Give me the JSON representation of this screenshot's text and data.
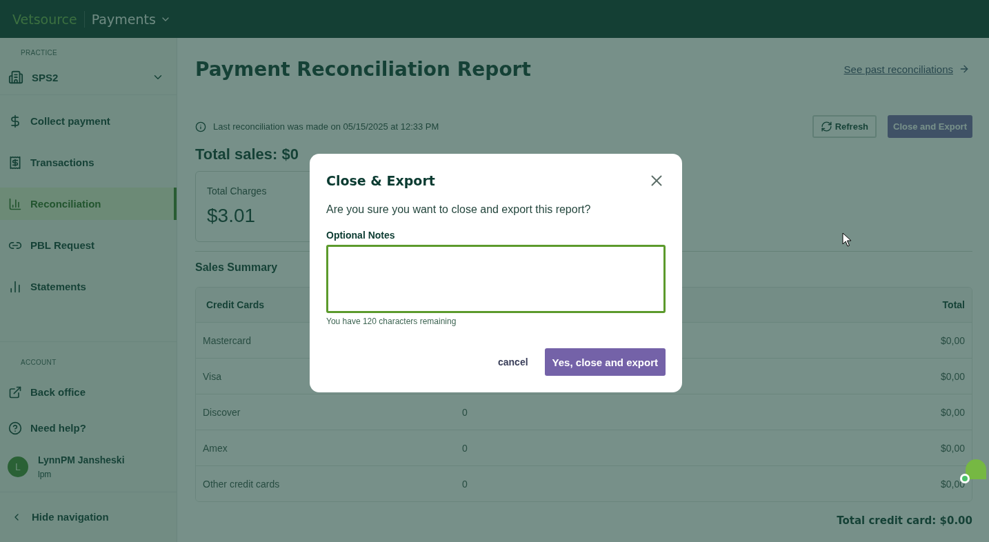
{
  "topbar": {
    "brand": "Vetsource",
    "product": "Payments"
  },
  "sidebar": {
    "practice_label": "PRACTICE",
    "practice": "SPS2",
    "items": [
      {
        "label": "Collect payment",
        "selected": false
      },
      {
        "label": "Transactions",
        "selected": false
      },
      {
        "label": "Reconciliation",
        "selected": true
      },
      {
        "label": "PBL Request",
        "selected": false
      },
      {
        "label": "Statements",
        "selected": false
      }
    ],
    "account_label": "ACCOUNT",
    "account_items": [
      {
        "label": "Back office"
      },
      {
        "label": "Need help?"
      }
    ],
    "user": {
      "initial": "L",
      "name": "LynnPM Jansheski",
      "handle": "lpm"
    },
    "hide": "Hide navigation"
  },
  "page": {
    "title": "Payment Reconciliation Report",
    "past_link": "See past reconciliations",
    "last_note": "Last reconciliation was made on 05/15/2025 at 12:33 PM",
    "refresh": "Refresh",
    "close_export": "Close and Export",
    "total_sales": "Total sales: $0",
    "cards": [
      {
        "label": "Total Charges",
        "value": "$3.01"
      }
    ],
    "summary_title": "Sales Summary",
    "table": {
      "columns": [
        {
          "label": "Credit Cards"
        },
        {
          "label": "Total"
        }
      ],
      "rows": [
        {
          "name": "Mastercard",
          "total": "$0,00"
        },
        {
          "name": "Visa",
          "total": "$0,00"
        },
        {
          "name": "Discover",
          "count": "0",
          "total": "$0,00"
        },
        {
          "name": "Amex",
          "count": "0",
          "total": "$0,00"
        },
        {
          "name": "Other credit cards",
          "count": "0",
          "total": "$0,00"
        }
      ]
    },
    "total_credit": "Total credit card: $0.00"
  },
  "dialog": {
    "title": "Close & Export",
    "question": "Are you sure you want to close and export this report?",
    "notes_label": "Optional Notes",
    "helper": "You have 120 characters remaining",
    "cancel": "cancel",
    "confirm": "Yes, close and export"
  }
}
